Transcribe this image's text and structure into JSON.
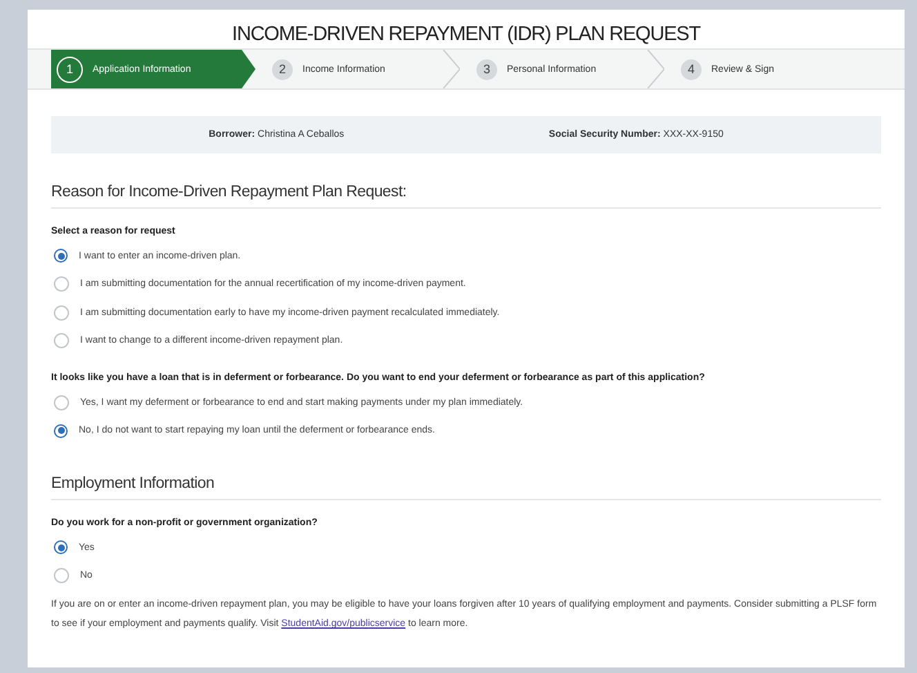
{
  "title": "INCOME-DRIVEN REPAYMENT (IDR) PLAN REQUEST",
  "steps": [
    {
      "number": "1",
      "label": "Application Information",
      "selected": true
    },
    {
      "number": "2",
      "label": "Income Information",
      "selected": false
    },
    {
      "number": "3",
      "label": "Personal Information",
      "selected": false
    },
    {
      "number": "4",
      "label": "Review & Sign",
      "selected": false
    }
  ],
  "borrower": {
    "label": "Borrower:",
    "value": "Christina A Ceballos",
    "ssn_label": "Social Security Number:",
    "ssn_value": "XXX-XX-9150"
  },
  "sections": [
    {
      "heading": "Reason for Income-Driven Repayment Plan Request:",
      "groups": [
        {
          "question": "Select a reason for request",
          "options": [
            {
              "label": "I want to enter an income-driven plan.",
              "selected": true
            },
            {
              "label": "I am submitting documentation for the annual recertification of my income-driven payment.",
              "selected": false
            },
            {
              "label": "I am submitting documentation early to have my income-driven payment recalculated immediately.",
              "selected": false
            },
            {
              "label": "I want to change to a different income-driven repayment plan.",
              "selected": false
            }
          ]
        },
        {
          "question": "It looks like you have a loan that is in deferment or forbearance. Do you want to end your deferment or forbearance as part of this application?",
          "options": [
            {
              "label": "Yes, I want my deferment or forbearance to end and start making payments under my plan immediately.",
              "selected": false
            },
            {
              "label": "No, I do not want to start repaying my loan until the deferment or forbearance ends.",
              "selected": true
            }
          ]
        }
      ]
    },
    {
      "heading": "Employment Information",
      "groups": [
        {
          "question": "Do you work for a non-profit or government organization?",
          "options": [
            {
              "label": "Yes",
              "selected": true
            },
            {
              "label": "No",
              "selected": false
            }
          ]
        }
      ]
    }
  ],
  "note": {
    "text_before": "If you are on or enter an income-driven repayment plan, you may be eligible to have your loans forgiven after 10 years of qualifying employment and payments. Consider submitting a PLSF form to see if your employment and payments qualify. Visit ",
    "link": "StudentAid.gov/publicservice",
    "text_after": " to learn more."
  }
}
